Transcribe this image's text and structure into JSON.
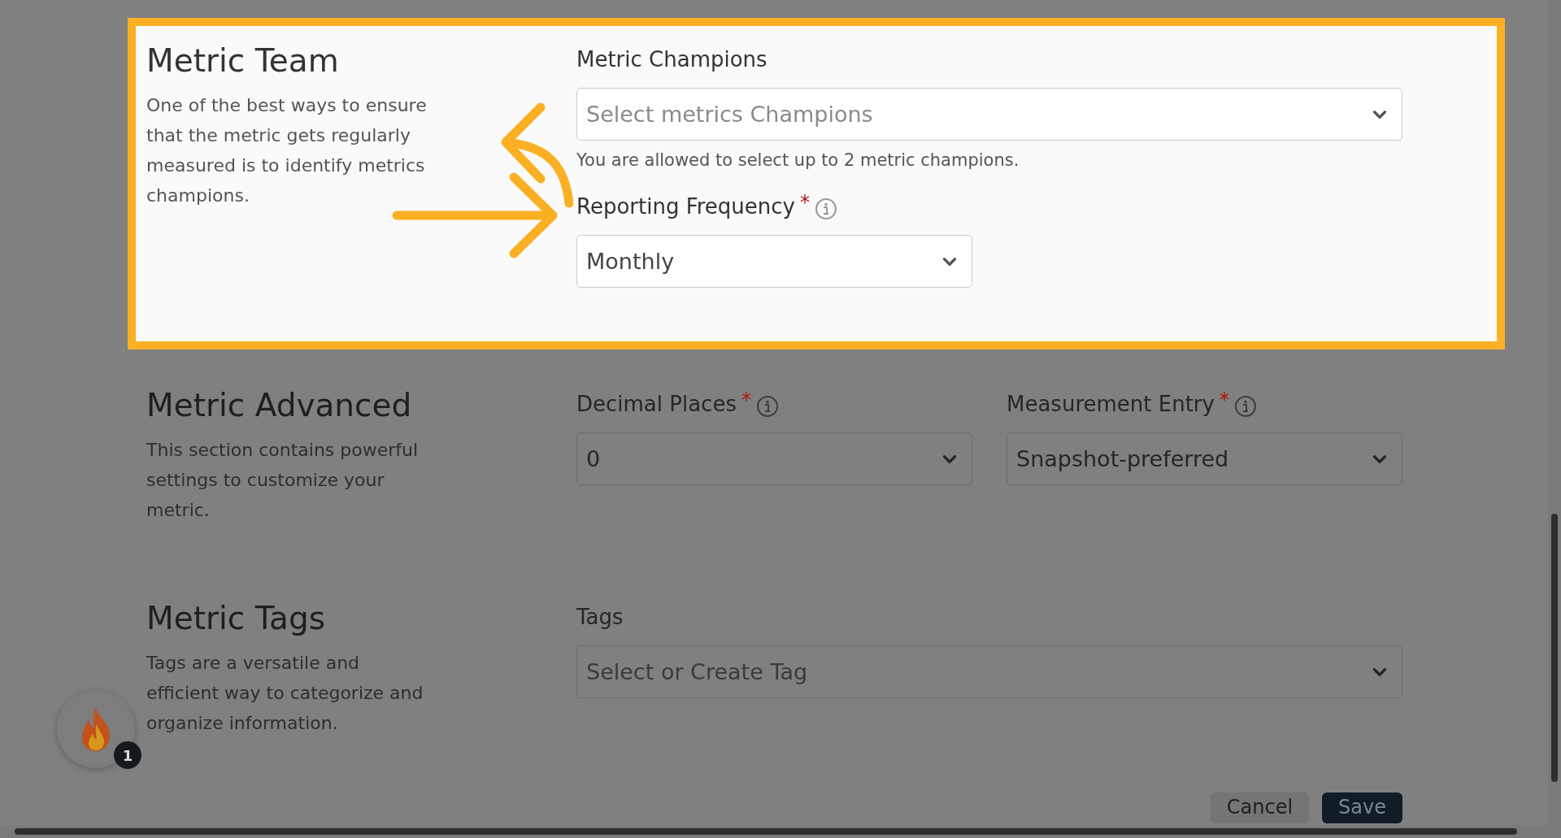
{
  "sections": [
    {
      "title": "Metric Team",
      "description": "One of the best ways to ensure that the metric gets regularly measured is to identify metrics champions.",
      "highlighted": true,
      "rows": [
        [
          {
            "kind": "multi-select",
            "label": "Metric Champions",
            "placeholder": "Select metrics Champions",
            "hint": "You are allowed to select up to 2 metric champions."
          }
        ],
        [
          {
            "kind": "select",
            "label": "Reporting Frequency",
            "required_mark": "*",
            "info": true,
            "value": "Monthly"
          }
        ]
      ]
    },
    {
      "title": "Metric Advanced",
      "description": "This section contains powerful settings to customize your metric.",
      "highlighted": false,
      "rows": [
        [
          {
            "kind": "select",
            "label": "Decimal Places",
            "required_mark": "*",
            "info": true,
            "value": "0"
          },
          {
            "kind": "select",
            "label": "Measurement Entry",
            "required_mark": "*",
            "info": true,
            "value": "Snapshot-preferred"
          }
        ]
      ]
    },
    {
      "title": "Metric Tags",
      "description": "Tags are a versatile and efficient way to categorize and organize information.",
      "highlighted": false,
      "rows": [
        [
          {
            "kind": "multi-select",
            "label": "Tags",
            "placeholder": "Select or Create Tag"
          }
        ]
      ]
    }
  ],
  "footer": {
    "buttons": [
      {
        "label": "Cancel",
        "kind": "secondary"
      },
      {
        "label": "Save",
        "kind": "primary"
      }
    ]
  },
  "widget": {
    "badge": "1"
  }
}
